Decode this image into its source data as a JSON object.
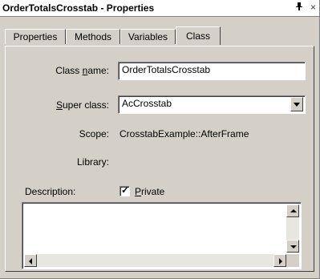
{
  "window": {
    "title": "OrderTotalsCrosstab - Properties",
    "pin_glyph": "1",
    "close_glyph": "×"
  },
  "tabs": [
    {
      "label": "Properties",
      "active": false
    },
    {
      "label": "Methods",
      "active": false
    },
    {
      "label": "Variables",
      "active": false
    },
    {
      "label": "Class",
      "active": true
    }
  ],
  "form": {
    "class_name": {
      "label_pre": "Class ",
      "label_ul": "n",
      "label_post": "ame:",
      "value": "OrderTotalsCrosstab"
    },
    "super_class": {
      "label_pre": "",
      "label_ul": "S",
      "label_post": "uper class:",
      "value": "AcCrosstab"
    },
    "scope": {
      "label": "Scope:",
      "value": "CrosstabExample::AfterFrame"
    },
    "library": {
      "label": "Library:",
      "value": ""
    },
    "description": {
      "label": "Description:",
      "value": ""
    },
    "private": {
      "label_ul": "P",
      "label_post": "rivate",
      "checked": true,
      "check_glyph": "✓"
    }
  }
}
